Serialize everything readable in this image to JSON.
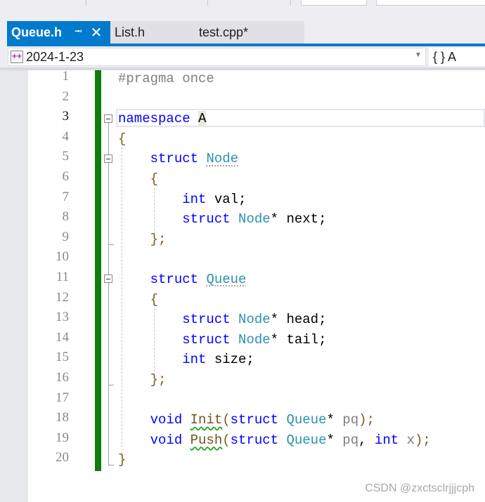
{
  "tabs": [
    {
      "label": "Queue.h",
      "active": true,
      "pin_icon": "pin-icon",
      "close_icon": "close-icon"
    },
    {
      "label": "List.h",
      "active": false
    },
    {
      "label": "test.cpp*",
      "active": false
    }
  ],
  "nav": {
    "scope": "2024-1-23",
    "member": "{ } A"
  },
  "editor": {
    "current_line": 3,
    "lines": [
      [
        [
          "#pragma once",
          "pp"
        ]
      ],
      [],
      [
        [
          "namespace ",
          "kw"
        ],
        [
          "A",
          "tx hl"
        ]
      ],
      [
        [
          "{",
          "br"
        ]
      ],
      [
        [
          "    ",
          ""
        ],
        [
          "struct ",
          "kw"
        ],
        [
          "Node",
          "ty dots"
        ]
      ],
      [
        [
          "    ",
          ""
        ],
        [
          "{",
          "br"
        ]
      ],
      [
        [
          "        ",
          ""
        ],
        [
          "int ",
          "kw"
        ],
        [
          "val;",
          "tx"
        ]
      ],
      [
        [
          "        ",
          ""
        ],
        [
          "struct ",
          "kw"
        ],
        [
          "Node",
          "ty"
        ],
        [
          "* next;",
          "tx"
        ]
      ],
      [
        [
          "    ",
          ""
        ],
        [
          "};",
          "br"
        ]
      ],
      [],
      [
        [
          "    ",
          ""
        ],
        [
          "struct ",
          "kw"
        ],
        [
          "Queue",
          "ty dots"
        ]
      ],
      [
        [
          "    ",
          ""
        ],
        [
          "{",
          "br"
        ]
      ],
      [
        [
          "        ",
          ""
        ],
        [
          "struct ",
          "kw"
        ],
        [
          "Node",
          "ty"
        ],
        [
          "* head;",
          "tx"
        ]
      ],
      [
        [
          "        ",
          ""
        ],
        [
          "struct ",
          "kw"
        ],
        [
          "Node",
          "ty"
        ],
        [
          "* tail;",
          "tx"
        ]
      ],
      [
        [
          "        ",
          ""
        ],
        [
          "int ",
          "kw"
        ],
        [
          "size;",
          "tx"
        ]
      ],
      [
        [
          "    ",
          ""
        ],
        [
          "};",
          "br"
        ]
      ],
      [],
      [
        [
          "    ",
          ""
        ],
        [
          "void ",
          "kw"
        ],
        [
          "Init",
          "fn sq"
        ],
        [
          "(",
          "br"
        ],
        [
          "struct ",
          "kw"
        ],
        [
          "Queue",
          "ty"
        ],
        [
          "* ",
          "tx"
        ],
        [
          "pq",
          "pa"
        ],
        [
          ");",
          "br"
        ]
      ],
      [
        [
          "    ",
          ""
        ],
        [
          "void ",
          "kw"
        ],
        [
          "Push",
          "fn sq"
        ],
        [
          "(",
          "br"
        ],
        [
          "struct ",
          "kw"
        ],
        [
          "Queue",
          "ty"
        ],
        [
          "* ",
          "tx"
        ],
        [
          "pq",
          "pa"
        ],
        [
          ", ",
          "tx"
        ],
        [
          "int ",
          "kw"
        ],
        [
          "x",
          "pa"
        ],
        [
          ");",
          "br"
        ]
      ],
      [
        [
          "}",
          "br"
        ]
      ]
    ]
  },
  "watermark": "CSDN @zxctsclrjjjcph"
}
